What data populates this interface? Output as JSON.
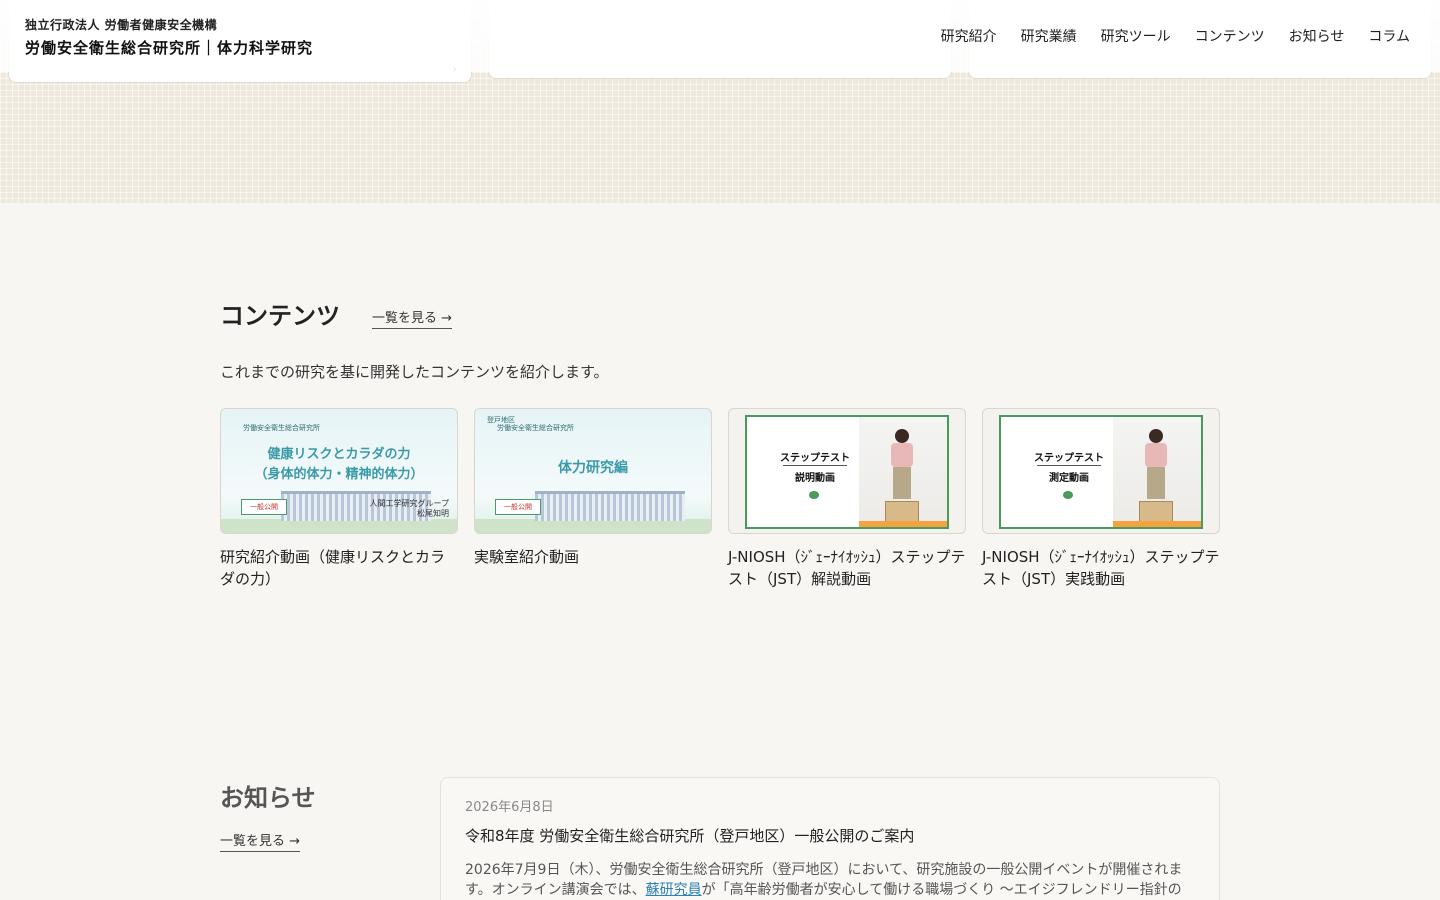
{
  "header": {
    "org": "独立行政法人 労働者健康安全機構",
    "title": "労働安全衛生総合研究所｜体力科学研究",
    "nav": [
      "研究紹介",
      "研究業績",
      "研究ツール",
      "コンテンツ",
      "お知らせ",
      "コラム"
    ]
  },
  "contents": {
    "title": "コンテンツ",
    "more": "一覧を見る →",
    "description": "これまでの研究を基に開発したコンテンツを紹介します。",
    "cards": [
      {
        "label": "研究紹介動画（健康リスクとカラダの力）",
        "thumb_org": "労働安全衛生総合研究所",
        "thumb_title": "健康リスクとカラダの力",
        "thumb_sub": "（身体的体力・精神的体力）",
        "thumb_sign": "一般公開",
        "thumb_credit_1": "人間工学研究グループ",
        "thumb_credit_2": "松尾知明"
      },
      {
        "label": "実験室紹介動画",
        "thumb_org_1": "登戸地区",
        "thumb_org_2": "労働安全衛生総合研究所",
        "thumb_title": "体力研究編",
        "thumb_sign": "一般公開"
      },
      {
        "label": "J-NIOSH（ｼﾞｪｰﾅｲｵｯｼｭ）ステップテスト（JST）解説動画",
        "thumb_title": "ステップテスト",
        "thumb_sub": "説明動画"
      },
      {
        "label": "J-NIOSH（ｼﾞｪｰﾅｲｵｯｼｭ）ステップテスト（JST）実践動画",
        "thumb_title": "ステップテスト",
        "thumb_sub": "測定動画"
      }
    ]
  },
  "news": {
    "title": "お知らせ",
    "more": "一覧を見る →",
    "item": {
      "date": "2026年6月8日",
      "headline": "令和8年度 労働安全衛生総合研究所（登戸地区）一般公開のご案内",
      "body_1": "2026年7月9日（木）、労働安全衛生総合研究所（登戸地区）において、研究施設の一般公開イベントが開催されます。オンライン講演会では、",
      "link": "蘇研究員",
      "body_2": "が「高年齢労働者が安心して働ける職場づくり 〜エイジフレンドリー指針の"
    }
  }
}
